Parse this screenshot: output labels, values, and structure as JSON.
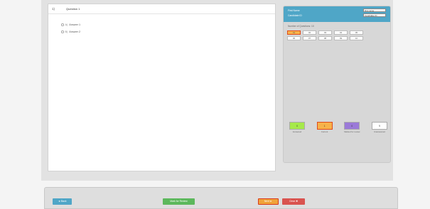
{
  "question": {
    "number": "1)",
    "text": "Question 1",
    "options": [
      {
        "letter": "A)",
        "label": "Answer 1"
      },
      {
        "letter": "B)",
        "label": "Answer 2"
      }
    ]
  },
  "sidebar": {
    "first_name_label": "First Name",
    "first_name_value": "first name",
    "candidate_id_label": "Candidate ID",
    "candidate_id_value": "Candidate ID",
    "count_label": "Number of Questions: 10",
    "questions": [
      "01",
      "02",
      "03",
      "04",
      "05",
      "06",
      "07",
      "08",
      "09",
      "10"
    ],
    "current_index": 0
  },
  "legend": [
    {
      "count": "0",
      "label": "Answered",
      "state": "answered"
    },
    {
      "count": "1",
      "label": "Current",
      "state": "current"
    },
    {
      "count": "0",
      "label": "Marked for review",
      "state": "review"
    },
    {
      "count": "9",
      "label": "Unanswered",
      "state": "unanswered"
    }
  ],
  "footer": {
    "back_label": "◄ Back",
    "mark_label": "Mark for Review",
    "next_label": "Next ►",
    "clear_label": "Clear ✖"
  },
  "colors": {
    "accent": "#4fa6c7",
    "answered": "#a6e94a",
    "current": "#f7b24a",
    "review": "#9b7ad8",
    "danger": "#d9534f",
    "success": "#5cb85c"
  }
}
